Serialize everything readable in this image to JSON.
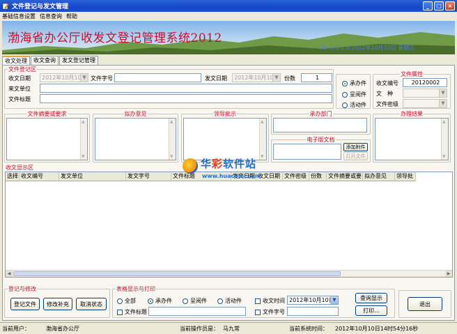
{
  "window": {
    "title": "文件登记与发文管理"
  },
  "menu": [
    "基础信息设置",
    "信息查询",
    "帮助"
  ],
  "banner": {
    "title": "渤海省办公厅收发文登记管理系统2012",
    "subtitle": "Ver 1.0.1.0 2012年10月10日 星期三"
  },
  "tabs": [
    "收文处理",
    "收文查询",
    "发文登记管理"
  ],
  "register": {
    "section_label": "文件登记区",
    "date_label": "收文日期",
    "date_value": "2012年10月10日",
    "doc_no_label": "文件字号",
    "doc_no_value": "",
    "issue_date_label": "发文日期",
    "issue_date_value": "2012年10月10日",
    "copies_label": "份数",
    "copies_value": "1",
    "unit_label": "来文单位",
    "unit_value": "",
    "subject_label": "文件标题",
    "subject_value": ""
  },
  "doc_type": {
    "options": [
      "承办件",
      "呈阅件",
      "活动件"
    ],
    "selected": 0
  },
  "attrs": {
    "section_label": "文件属性",
    "serial_label": "收文编号",
    "serial_value": "20120002",
    "kind_label": "文　种",
    "kind_value": "",
    "secret_label": "文件密级",
    "secret_value": ""
  },
  "sections": {
    "summary": "文件摘要或要求",
    "opinion": "拟办意见",
    "leader": "领导批示",
    "dept": "承办部门",
    "edoc": "电子版文档",
    "result": "办理结果",
    "display": "收文显示区",
    "edit": "登记与修改",
    "print": "表格显示与打印"
  },
  "edoc_buttons": {
    "add": "添加附件",
    "open": "打开文件"
  },
  "grid": {
    "columns": [
      "选择",
      "收文编号",
      "发文单位",
      "发文字号",
      "文件标题",
      "发文日期",
      "收文日期",
      "文件密级",
      "份数",
      "文件摘要或要",
      "拟办意见",
      "领导批"
    ]
  },
  "edit_buttons": {
    "register": "登记文件",
    "modify": "修改补充",
    "cancel": "取消状态"
  },
  "print": {
    "options": [
      "全部",
      "承办件",
      "呈阅件",
      "活动件"
    ],
    "selected": 1,
    "time_label": "收文时间",
    "time_value": "2012年10月10日",
    "title_label": "文件标题",
    "title_value": "",
    "docno_label": "文件字号",
    "docno_value": "",
    "query_button": "查询显示",
    "print_button": "打印..."
  },
  "exit_button": "退出",
  "statusbar": {
    "user_label": "当前用户：",
    "user_value": "渤海省办公厅",
    "operator_label": "当前操作员是：",
    "operator_value": "马九常",
    "time_label": "当前系统时间：",
    "time_value": "2012年10月10日14时54分16秒"
  },
  "watermark": {
    "brand_a": "华",
    "brand_b": "彩",
    "brand_c": "软件站",
    "url": "www.huacolor.com"
  },
  "colors": {
    "section_label": "#c8102e",
    "titlebar": "#1548c8",
    "banner_title": "#c8102e",
    "watermark_blue": "#1e70d0",
    "watermark_red": "#e33c1e"
  },
  "icons": {
    "app": "pencil-doc-icon",
    "minimize": "minimize-icon",
    "maximize": "maximize-icon",
    "close": "close-icon"
  }
}
